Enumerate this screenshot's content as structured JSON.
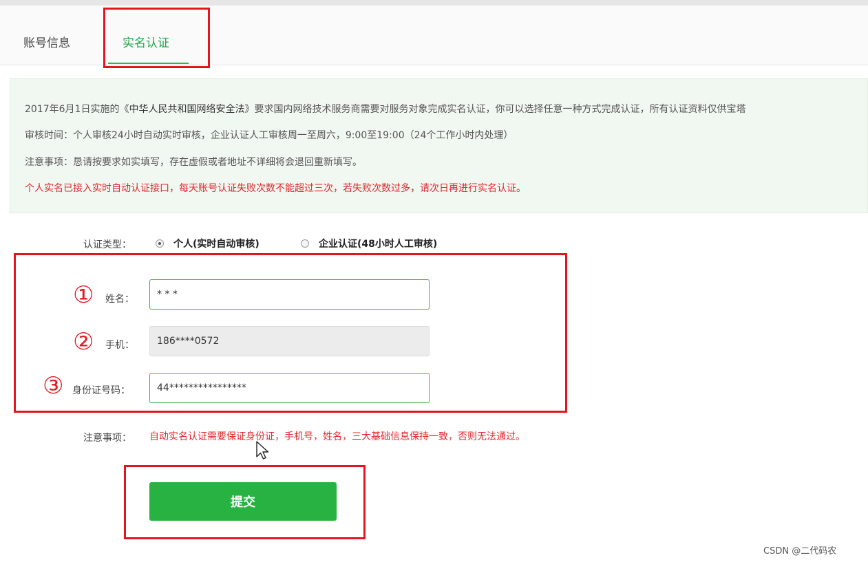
{
  "tabs": {
    "account_info": "账号信息",
    "real_name": "实名认证"
  },
  "notice": {
    "line1_prefix": "2017年6月1日实施的《",
    "law_name": "中华人民共和国网络安全法",
    "line1_suffix": "》要求国内网络技术服务商需要对服务对象完成实名认证，你可以选择任意一种方式完成认证，所有认证资料仅供宝塔",
    "line2": "审核时间：个人审核24小时自动实时审核，企业认证人工审核周一至周六，9:00至19:00（24个工作小时内处理）",
    "line3": "注意事项：恳请按要求如实填写，存在虚假或者地址不详细将会退回重新填写。",
    "line4": "个人实名已接入实时自动认证接口，每天账号认证失败次数不能超过三次，若失败次数过多，请次日再进行实名认证。"
  },
  "form": {
    "type_label": "认证类型：",
    "type_options": [
      "个人(实时自动审核)",
      "企业认证(48小时人工审核)"
    ],
    "selected_type": "个人(实时自动审核)",
    "name_label": "姓名：",
    "name_value": "* * *",
    "phone_label": "手机：",
    "phone_value": "186****0572",
    "id_label": "身份证号码：",
    "id_value": "44****************",
    "note_label": "注意事项：",
    "note_text": "自动实名认证需要保证身份证，手机号，姓名，三大基础信息保持一致，否则无法通过。",
    "submit_label": "提交"
  },
  "annotations": {
    "markers": [
      "①",
      "②",
      "③"
    ],
    "box_color": "#e4151f"
  },
  "watermark": "CSDN @二代码农",
  "colors": {
    "accent_green": "#27b241",
    "warning_red": "#e0282e"
  }
}
